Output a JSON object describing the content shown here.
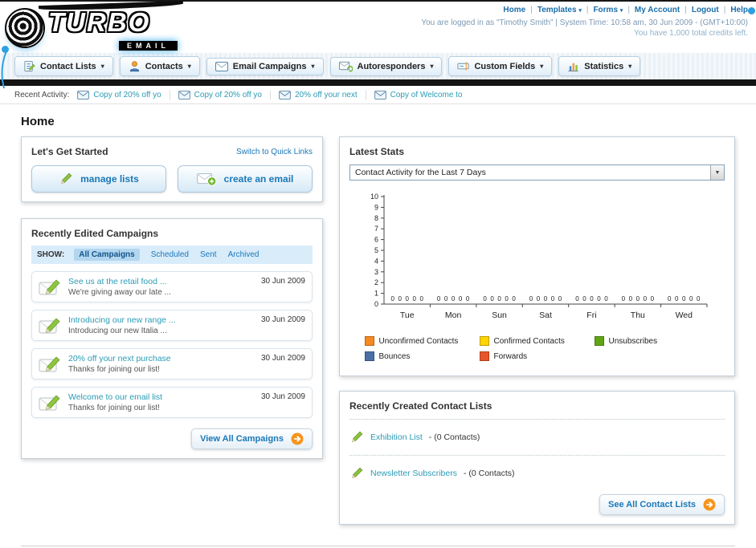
{
  "page_title": "Home",
  "header": {
    "logo": {
      "title": "TURBO",
      "subtitle": "EMAIL"
    },
    "nav_links": [
      {
        "label": "Home",
        "dropdown": false
      },
      {
        "label": "Templates",
        "dropdown": true
      },
      {
        "label": "Forms",
        "dropdown": true
      },
      {
        "label": "My Account",
        "dropdown": false
      },
      {
        "label": "Logout",
        "dropdown": false
      },
      {
        "label": "Help",
        "dropdown": false
      }
    ],
    "login_info": "You are logged in as \"Timothy Smith\" | System Time: 10:58 am, 30 Jun 2009 - (GMT+10:00)",
    "credits_info": "You have 1,000 total credits left."
  },
  "main_nav": {
    "tabs": [
      {
        "label": "Contact Lists",
        "icon": "contact-lists"
      },
      {
        "label": "Contacts",
        "icon": "contacts"
      },
      {
        "label": "Email Campaigns",
        "icon": "email-campaigns"
      },
      {
        "label": "Autoresponders",
        "icon": "autoresponders"
      },
      {
        "label": "Custom Fields",
        "icon": "custom-fields"
      },
      {
        "label": "Statistics",
        "icon": "statistics"
      }
    ]
  },
  "recent_activity": {
    "label": "Recent Activity:",
    "items": [
      "Copy of 20% off yo",
      "Copy of 20% off yo",
      "20% off your next",
      "Copy of Welcome to"
    ]
  },
  "get_started": {
    "title": "Let's Get Started",
    "switch_link": "Switch to Quick Links",
    "buttons": [
      {
        "label": "manage lists"
      },
      {
        "label": "create an email"
      }
    ]
  },
  "campaigns": {
    "title": "Recently Edited Campaigns",
    "show_label": "SHOW:",
    "tabs": [
      {
        "label": "All Campaigns",
        "active": true
      },
      {
        "label": "Scheduled",
        "active": false
      },
      {
        "label": "Sent",
        "active": false
      },
      {
        "label": "Archived",
        "active": false
      }
    ],
    "items": [
      {
        "title": "See us at the retail food ...",
        "subtitle": "We're giving away our late ...",
        "date": "30 Jun 2009"
      },
      {
        "title": "Introducing our new range ...",
        "subtitle": "Introducing our new Italia ...",
        "date": "30 Jun 2009"
      },
      {
        "title": "20% off your next purchase",
        "subtitle": "Thanks for joining our list!",
        "date": "30 Jun 2009"
      },
      {
        "title": "Welcome to our email list",
        "subtitle": "Thanks for joining our list!",
        "date": "30 Jun 2009"
      }
    ],
    "view_all_label": "View All Campaigns"
  },
  "stats": {
    "title": "Latest Stats",
    "period_value": "Contact Activity for the Last 7 Days",
    "chart_data": {
      "type": "bar",
      "title": "Contact Activity for the Last 7 Days",
      "categories": [
        "Tue",
        "Mon",
        "Sun",
        "Sat",
        "Fri",
        "Thu",
        "Wed"
      ],
      "series": [
        {
          "name": "Unconfirmed Contacts",
          "color": "#f6891f",
          "values": [
            0,
            0,
            0,
            0,
            0,
            0,
            0
          ]
        },
        {
          "name": "Confirmed Contacts",
          "color": "#ffd400",
          "values": [
            0,
            0,
            0,
            0,
            0,
            0,
            0
          ]
        },
        {
          "name": "Unsubscribes",
          "color": "#61a515",
          "values": [
            0,
            0,
            0,
            0,
            0,
            0,
            0
          ]
        },
        {
          "name": "Bounces",
          "color": "#4a6fa5",
          "values": [
            0,
            0,
            0,
            0,
            0,
            0,
            0
          ]
        },
        {
          "name": "Forwards",
          "color": "#e8552a",
          "values": [
            0,
            0,
            0,
            0,
            0,
            0,
            0
          ]
        }
      ],
      "ylim": [
        0,
        10
      ],
      "ytick_step": 1,
      "grid": false,
      "legend_position": "bottom"
    }
  },
  "contact_lists": {
    "title": "Recently Created Contact Lists",
    "items": [
      {
        "name": "Exhibition List",
        "detail": "(0 Contacts)"
      },
      {
        "name": "Newsletter Subscribers",
        "detail": "(0 Contacts)"
      }
    ],
    "see_all_label": "See All Contact Lists"
  },
  "colors": {
    "link_blue": "#1a78b8",
    "teal_link": "#2a9bb5",
    "accent_orange": "#f7941d",
    "bar_black": "#141414"
  }
}
